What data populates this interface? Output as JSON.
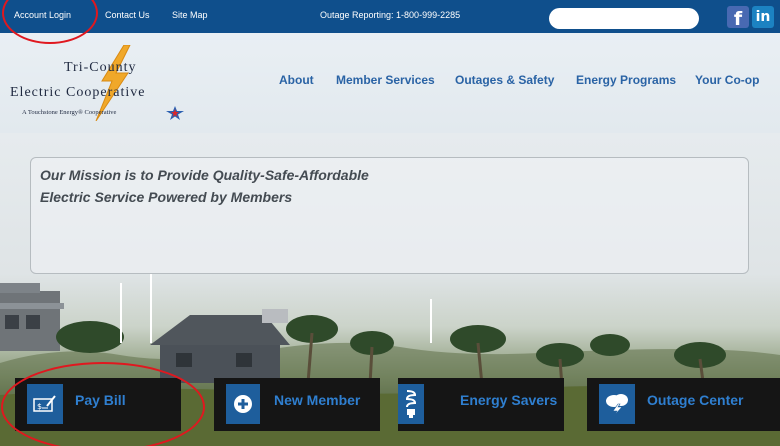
{
  "topbar": {
    "account_login": "Account Login",
    "contact_us": "Contact Us",
    "site_map": "Site Map",
    "outage_reporting": "Outage Reporting: 1-800-999-2285",
    "search_value": "",
    "facebook_glyph": "f",
    "linkedin_glyph": "in"
  },
  "logo": {
    "line1": "Tri-County",
    "line2": "Electric Cooperative",
    "tagline": "A Touchstone Energy® Cooperative"
  },
  "nav": {
    "about": "About",
    "member_services": "Member Services",
    "outages_safety": "Outages & Safety",
    "energy_programs": "Energy Programs",
    "your_coop": "Your Co-op"
  },
  "mission": {
    "line1": "Our Mission is to Provide Quality-Safe-Affordable",
    "line2": "Electric Service Powered by Members"
  },
  "tiles": {
    "pay_bill": "Pay Bill",
    "new_member": "New Member",
    "energy_savers": "Energy Savers",
    "outage_center": "Outage Center"
  },
  "colors": {
    "topbar": "#0f4f8c",
    "nav_link": "#2a63a5",
    "tile_bg": "#151515",
    "tile_icon": "#1e5e9c",
    "tile_text": "#2f7fd0",
    "annotation": "#e0181f"
  }
}
